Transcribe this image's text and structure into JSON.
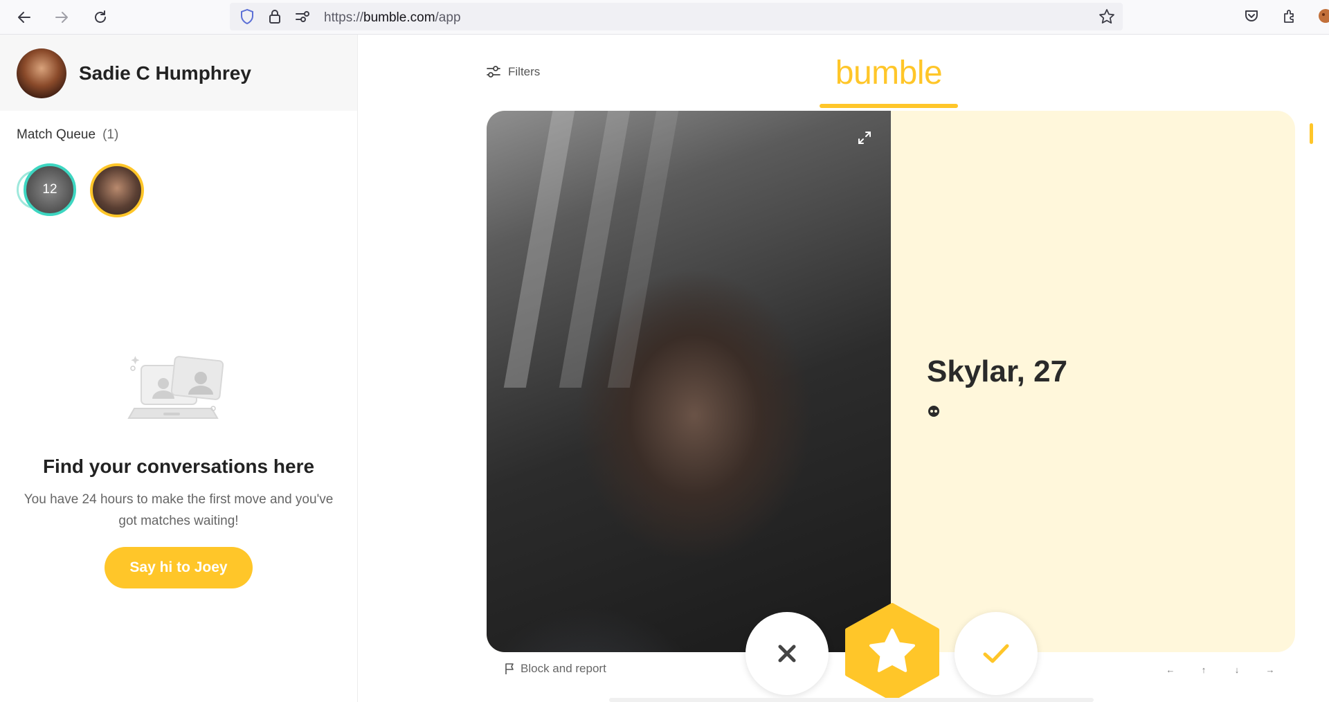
{
  "browser": {
    "url_prefix": "https://",
    "url_domain": "bumble.com",
    "url_path": "/app",
    "icons": [
      "back-arrow-icon",
      "forward-arrow-icon",
      "reload-icon",
      "shield-icon",
      "lock-icon",
      "permissions-icon",
      "bookmark-star-icon",
      "pocket-icon",
      "extensions-icon"
    ]
  },
  "sidebar": {
    "user_name": "Sadie C Humphrey",
    "match_queue_label": "Match Queue",
    "match_queue_count": "(1)",
    "queue_stack_count": "12",
    "empty_title": "Find your conversations here",
    "empty_desc": "You have 24 hours to make the first move and you've got matches waiting!",
    "cta_label": "Say hi to Joey"
  },
  "main": {
    "filters_label": "Filters",
    "brand": "bumble",
    "profile_name_age": "Skylar, 27",
    "block_report_label": "Block and report",
    "keyboard_hints": [
      "←",
      "↑",
      "↓",
      "→"
    ]
  },
  "colors": {
    "brand_yellow": "#ffc629",
    "card_background": "#fff7db",
    "queue_teal": "#3dd6c1"
  }
}
